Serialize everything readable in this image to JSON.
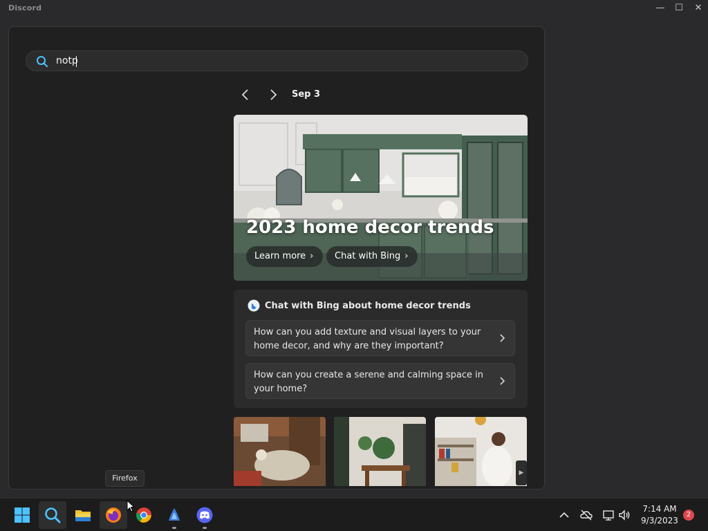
{
  "window": {
    "title": "Discord",
    "controls": {
      "minimize": "—",
      "maximize": "☐",
      "close": "✕"
    }
  },
  "search": {
    "value": "notp",
    "icon": "search-icon"
  },
  "feed": {
    "date": "Sep 3",
    "hero": {
      "title": "2023 home decor trends",
      "learn_more": "Learn more",
      "chat_with_bing": "Chat with Bing"
    },
    "bing_card": {
      "header": "Chat with Bing about home decor trends",
      "questions": [
        "How can you add texture and visual layers to your home decor, and why are they important?",
        "How can you create a serene and calming space in your home?"
      ]
    },
    "thumbnails": [
      "living-room-thumbnail",
      "dining-room-thumbnail",
      "bookshelf-room-thumbnail"
    ]
  },
  "tooltip": "Firefox",
  "taskbar": {
    "apps": [
      "start-icon",
      "search-icon",
      "file-explorer-icon",
      "firefox-icon",
      "chrome-icon",
      "app-icon",
      "discord-icon"
    ],
    "time": "7:14 AM",
    "date": "9/3/2023",
    "notifications": "2"
  },
  "colors": {
    "background": "#202020",
    "taskbar": "#1c1c1c",
    "accent": "#4cc2ff",
    "badge": "#e0474d"
  }
}
